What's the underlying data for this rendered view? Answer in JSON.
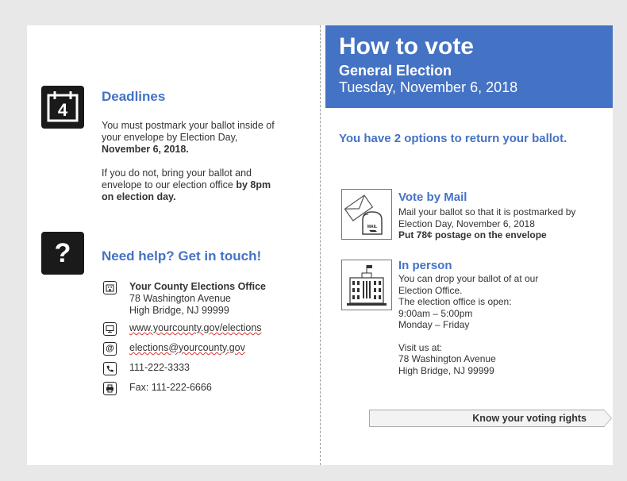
{
  "deadlines": {
    "calendar_number": "4",
    "title": "Deadlines",
    "para1_a": "You must postmark your ballot inside of your envelope by Election Day, ",
    "para1_b": "November 6, 2018.",
    "para2_a": "If you do not, bring your ballot and envelope to our election office ",
    "para2_b": "by 8pm on election day."
  },
  "help": {
    "icon_glyph": "?",
    "title": "Need help? Get in touch!",
    "office_name": "Your County Elections Office",
    "address_line1": "78 Washington Avenue",
    "address_line2": "High Bridge, NJ 99999",
    "website": "www.yourcounty.gov/elections",
    "email": "elections@yourcounty.gov",
    "phone": "111-222-3333",
    "fax": "Fax: 111-222-6666"
  },
  "banner": {
    "title": "How to vote",
    "subtitle": "General Election",
    "date": "Tuesday, November 6, 2018"
  },
  "options_title": "You have 2 options to return your ballot.",
  "mail": {
    "title": "Vote by Mail",
    "line1": "Mail your ballot so that it is postmarked by",
    "line2": "Election Day, November 6, 2018",
    "line3": "Put 78¢ postage on the envelope",
    "mailbox_label": "MAIL"
  },
  "in_person": {
    "title": "In person",
    "line1": "You can drop your ballot of at our",
    "line2": "Election Office.",
    "line3": "The election office is open:",
    "line4": "9:00am – 5:00pm",
    "line5": "Monday – Friday",
    "line6": "Visit us at:",
    "line7": "78 Washington Avenue",
    "line8": "High Bridge, NJ 99999"
  },
  "rights_button": "Know your voting rights",
  "colors": {
    "accent": "#4472c4",
    "icon_bg": "#1a1a1a"
  }
}
